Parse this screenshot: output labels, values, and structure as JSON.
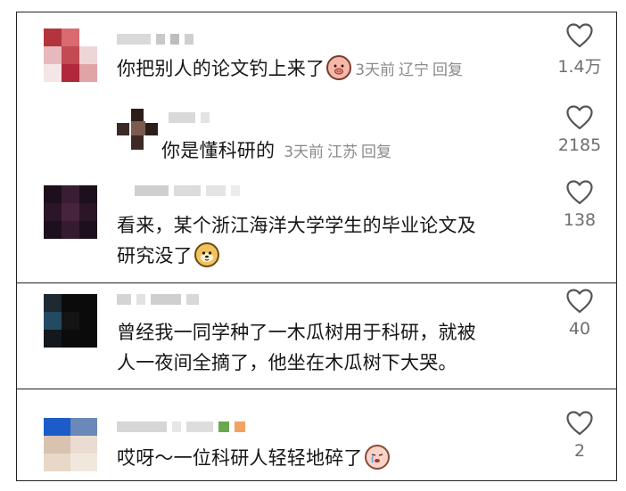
{
  "comments": [
    {
      "text": "你把别人的论文钓上来了",
      "emoji": "pig-face-emoji",
      "time": "3天前",
      "location": "辽宁",
      "reply_label": "回复",
      "likes": "1.4万"
    },
    {
      "text": "你是懂科研的",
      "time": "3天前",
      "location": "江苏",
      "reply_label": "回复",
      "likes": "2185"
    },
    {
      "text_line1": "看来，某个浙江海洋大学学生的毕业论文及",
      "text_line2": "研究没了",
      "emoji": "puppy-face-emoji",
      "likes": "138"
    },
    {
      "text_line1": "曾经我一同学种了一木瓜树用于科研，就被",
      "text_line2": "人一夜间全摘了，他坐在木瓜树下大哭。",
      "likes": "40"
    },
    {
      "text": "哎呀～一位科研人轻轻地碎了",
      "emoji": "crying-peach-emoji",
      "likes": "2"
    }
  ],
  "colors": {
    "text": "#161616",
    "meta": "#8a8a8a",
    "border": "#222222"
  }
}
